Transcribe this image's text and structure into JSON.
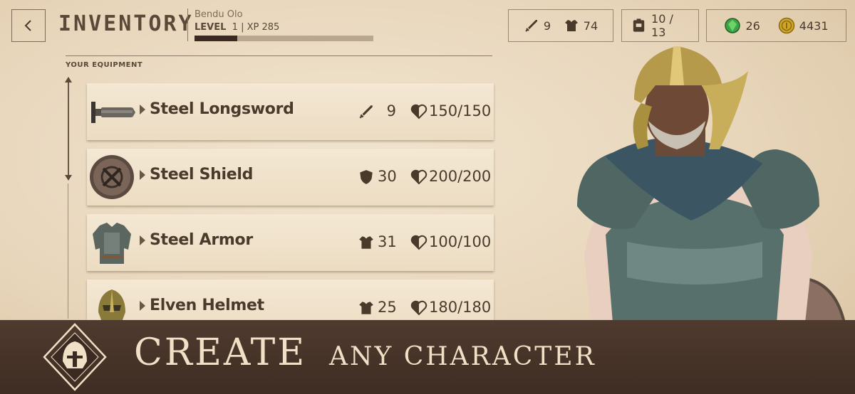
{
  "header": {
    "back_label": "<",
    "title": "INVENTORY",
    "player_name": "Bendu Olo",
    "level_label": "LEVEL",
    "level_value": "1",
    "xp_label": "XP 285",
    "xp_progress": 0.24
  },
  "resources": {
    "attack": "9",
    "armor": "74",
    "bag_count": "10 / 13",
    "gems": "26",
    "gold": "4431"
  },
  "equipment": {
    "section_label": "YOUR EQUIPMENT",
    "items": [
      {
        "name": "Steel Longsword",
        "stat_icon": "sword-icon",
        "stat": "9",
        "durability": "150/150"
      },
      {
        "name": "Steel Shield",
        "stat_icon": "shield-icon",
        "stat": "30",
        "durability": "200/200"
      },
      {
        "name": "Steel Armor",
        "stat_icon": "armor-icon",
        "stat": "31",
        "durability": "100/100"
      },
      {
        "name": "Elven Helmet",
        "stat_icon": "armor-icon",
        "stat": "25",
        "durability": "180/180"
      }
    ]
  },
  "banner": {
    "main": "CREATE",
    "sub": "ANY CHARACTER"
  },
  "colors": {
    "parchment": "#ecdcc2",
    "ink": "#4a3a2c",
    "banner": "#4a3629",
    "banner_text": "#efe0c6",
    "gem": "#3ea344",
    "gold": "#d1a526"
  }
}
